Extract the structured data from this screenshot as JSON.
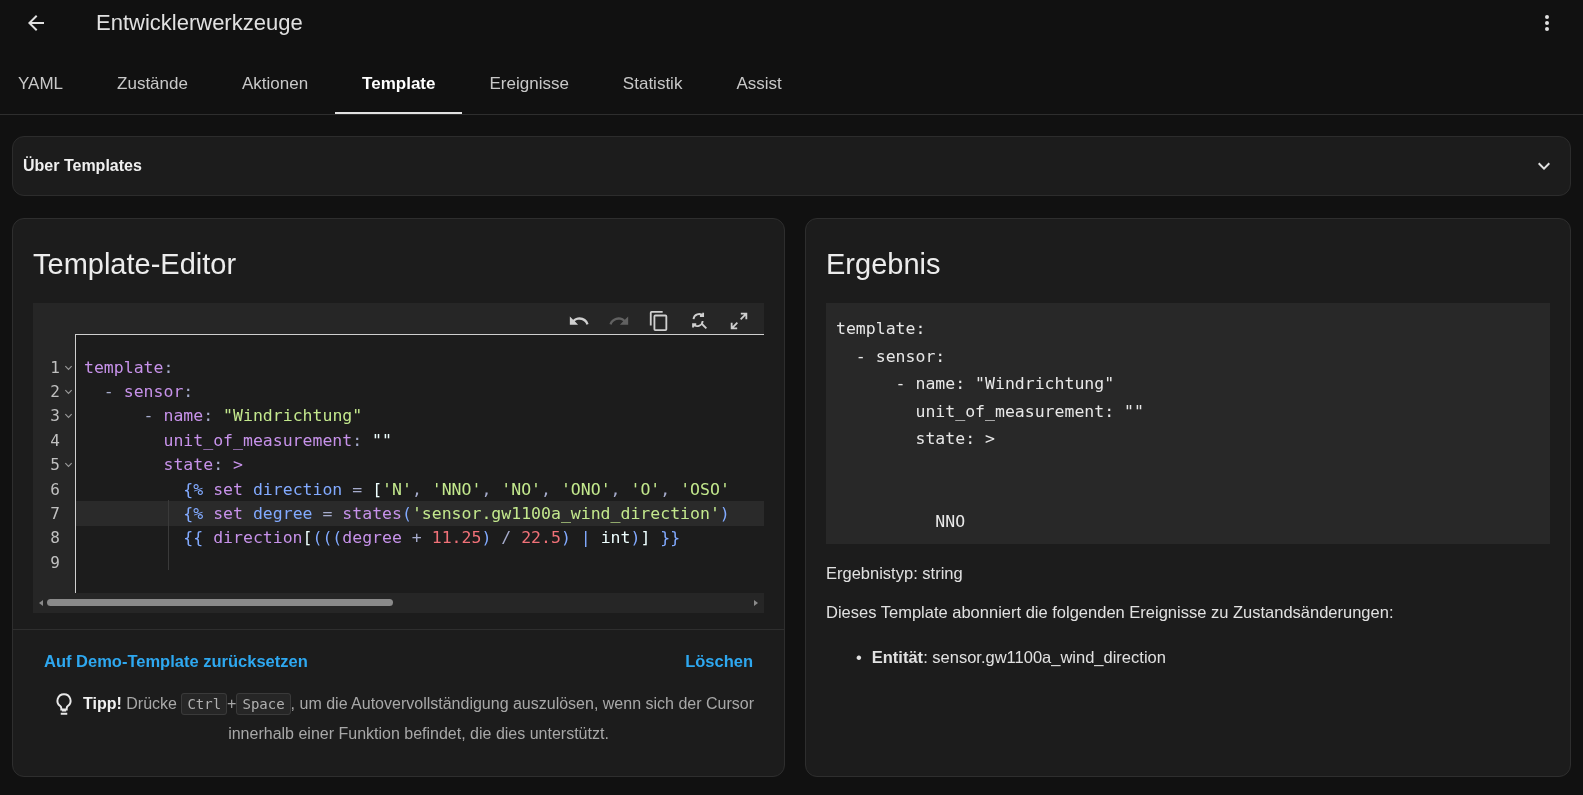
{
  "header": {
    "title": "Entwicklerwerkzeuge"
  },
  "tabs": [
    {
      "label": "YAML",
      "selected": false
    },
    {
      "label": "Zustände",
      "selected": false
    },
    {
      "label": "Aktionen",
      "selected": false
    },
    {
      "label": "Template",
      "selected": true
    },
    {
      "label": "Ereignisse",
      "selected": false
    },
    {
      "label": "Statistik",
      "selected": false
    },
    {
      "label": "Assist",
      "selected": false
    }
  ],
  "about_panel": {
    "title": "Über Templates",
    "expanded": false
  },
  "editor": {
    "title": "Template-Editor",
    "toolbar": [
      {
        "kind": "undo",
        "disabled": false
      },
      {
        "kind": "redo",
        "disabled": true
      },
      {
        "kind": "copy",
        "disabled": false
      },
      {
        "kind": "replace",
        "disabled": false
      },
      {
        "kind": "fullscreen",
        "disabled": false
      }
    ],
    "lines": [
      {
        "number": "1",
        "foldable": true,
        "active": false,
        "tokens": [
          {
            "kind": "key",
            "text": "template"
          },
          {
            "kind": "punct",
            "text": ":"
          }
        ]
      },
      {
        "number": "2",
        "foldable": true,
        "active": false,
        "tokens": [
          {
            "kind": "punct",
            "text": "  - "
          },
          {
            "kind": "key",
            "text": "sensor"
          },
          {
            "kind": "punct",
            "text": ":"
          }
        ]
      },
      {
        "number": "3",
        "foldable": true,
        "active": false,
        "tokens": [
          {
            "kind": "punct",
            "text": "      - "
          },
          {
            "kind": "key",
            "text": "name"
          },
          {
            "kind": "punct",
            "text": ": "
          },
          {
            "kind": "string",
            "text": "\"Windrichtung\""
          }
        ]
      },
      {
        "number": "4",
        "foldable": false,
        "active": false,
        "tokens": [
          {
            "kind": "key",
            "text": "        unit_of_measurement"
          },
          {
            "kind": "punct",
            "text": ": "
          },
          {
            "kind": "plain",
            "text": "\"\""
          }
        ]
      },
      {
        "number": "5",
        "foldable": true,
        "active": false,
        "tokens": [
          {
            "kind": "key",
            "text": "        state"
          },
          {
            "kind": "punct",
            "text": ": "
          },
          {
            "kind": "key",
            "text": ">"
          }
        ]
      },
      {
        "number": "6",
        "foldable": false,
        "active": false,
        "tokens": [
          {
            "kind": "tag",
            "text": "          {%"
          },
          {
            "kind": "keyword",
            "text": " set"
          },
          {
            "kind": "variable",
            "text": " direction"
          },
          {
            "kind": "punct",
            "text": " = "
          },
          {
            "kind": "plain",
            "text": "["
          },
          {
            "kind": "string",
            "text": "'N'"
          },
          {
            "kind": "punct",
            "text": ", "
          },
          {
            "kind": "string",
            "text": "'NNO'"
          },
          {
            "kind": "punct",
            "text": ", "
          },
          {
            "kind": "string",
            "text": "'NO'"
          },
          {
            "kind": "punct",
            "text": ", "
          },
          {
            "kind": "string",
            "text": "'ONO'"
          },
          {
            "kind": "punct",
            "text": ", "
          },
          {
            "kind": "string",
            "text": "'O'"
          },
          {
            "kind": "punct",
            "text": ", "
          },
          {
            "kind": "string",
            "text": "'OSO'"
          }
        ]
      },
      {
        "number": "7",
        "foldable": false,
        "active": true,
        "tokens": [
          {
            "kind": "tag",
            "text": "          {%"
          },
          {
            "kind": "keyword",
            "text": " set"
          },
          {
            "kind": "variable",
            "text": " degree"
          },
          {
            "kind": "punct",
            "text": " = "
          },
          {
            "kind": "keyword",
            "text": "states"
          },
          {
            "kind": "tag",
            "text": "("
          },
          {
            "kind": "string",
            "text": "'sensor.gw1100a_wind_direction'"
          },
          {
            "kind": "tag",
            "text": ")"
          }
        ]
      },
      {
        "number": "8",
        "foldable": false,
        "active": false,
        "tokens": [
          {
            "kind": "tag",
            "text": "          {{"
          },
          {
            "kind": "keyword",
            "text": " direction"
          },
          {
            "kind": "plain",
            "text": "["
          },
          {
            "kind": "tag",
            "text": "((("
          },
          {
            "kind": "keyword",
            "text": "degree"
          },
          {
            "kind": "punct",
            "text": " + "
          },
          {
            "kind": "number",
            "text": "11.25"
          },
          {
            "kind": "tag",
            "text": ")"
          },
          {
            "kind": "punct",
            "text": " / "
          },
          {
            "kind": "number",
            "text": "22.5"
          },
          {
            "kind": "tag",
            "text": ")"
          },
          {
            "kind": "tag",
            "text": " | "
          },
          {
            "kind": "plain",
            "text": "int"
          },
          {
            "kind": "tag",
            "text": ")"
          },
          {
            "kind": "plain",
            "text": "]"
          },
          {
            "kind": "tag",
            "text": " }}"
          }
        ]
      },
      {
        "number": "9",
        "foldable": false,
        "active": false
      }
    ],
    "reset_link": "Auf Demo-Template zurücksetzen",
    "clear_link": "Löschen",
    "tip": {
      "label": "Tipp!",
      "parts": [
        {
          "kind": "text",
          "text": "Drücke "
        },
        {
          "kind": "key",
          "text": "Ctrl"
        },
        {
          "kind": "text",
          "text": "+"
        },
        {
          "kind": "key",
          "text": "Space"
        },
        {
          "kind": "text",
          "text": ", um die Autovervollständigung auszulösen, wenn sich der Cursor innerhalb einer Funktion befindet, die dies unterstützt."
        }
      ]
    }
  },
  "result": {
    "title": "Ergebnis",
    "output": "template:\n  - sensor:\n      - name: \"Windrichtung\"\n        unit_of_measurement: \"\"\n        state: >\n\n\n          NNO",
    "type_text": "Ergebnistyp: string",
    "subscription_text": "Dieses Template abonniert die folgenden Ereignisse zu Zustandsänderungen:",
    "entities": [
      {
        "bullet": "•",
        "text": "**Entität**: sensor.gw1100a_wind_direction"
      }
    ]
  }
}
